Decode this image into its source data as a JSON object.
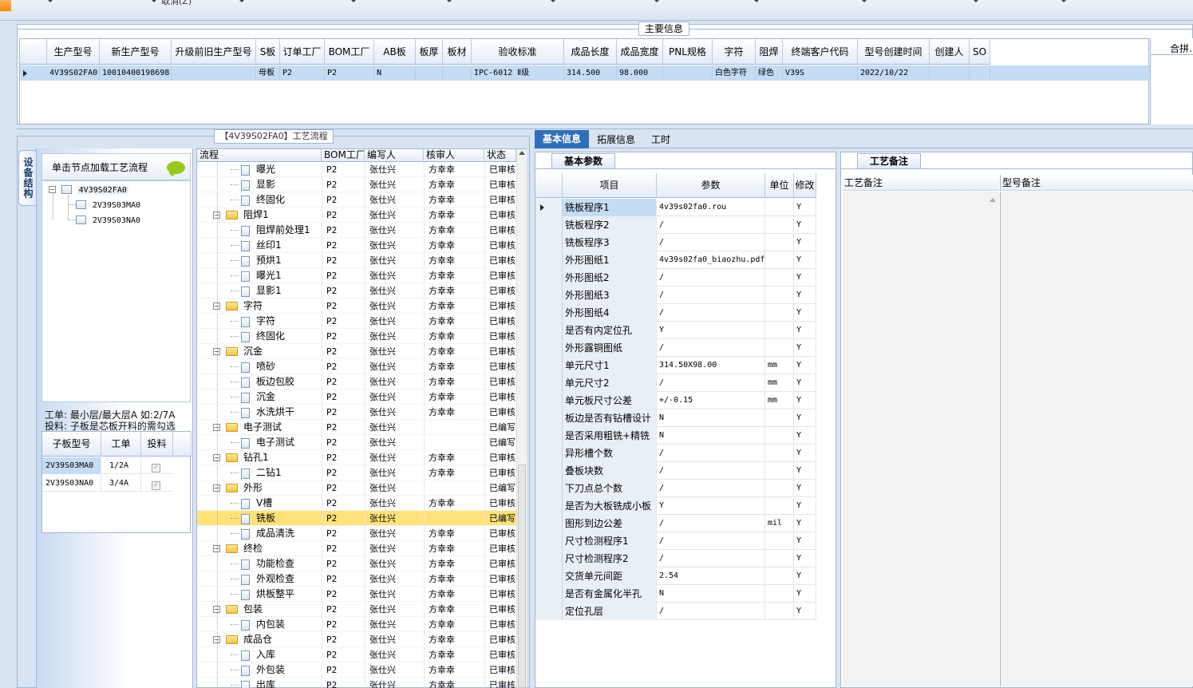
{
  "top_toolbar": {
    "partial_label": "取消(Z)"
  },
  "main_info": {
    "title": "主要信息",
    "columns": [
      "生产型号",
      "新生产型号",
      "升级前旧生产型号",
      "S板",
      "订单工厂",
      "BOM工厂",
      "AB板",
      "板厚",
      "板材",
      "验收标准",
      "成品长度",
      "成品宽度",
      "PNL规格",
      "字符",
      "阻焊",
      "终端客户代码",
      "型号创建时间",
      "创建人",
      "SO"
    ],
    "row": [
      "4V39S02FA0",
      "10010400198698",
      "",
      "母板",
      "P2",
      "P2",
      "N",
      "",
      "",
      "IPC-6012 Ⅱ级",
      "314.500",
      "98.000",
      "",
      "白色字符",
      "绿色",
      "V39S",
      "2022/10/22",
      "",
      ""
    ],
    "side_title": "合拼..."
  },
  "flow_title": "【4V39S02FA0】工艺流程",
  "vertical_tab": "设备结构",
  "tree_panel": {
    "hint": "单击节点加载工艺流程",
    "root": "4V39S02FA0",
    "children": [
      "2V39S03MA0",
      "2V39S03NA0"
    ]
  },
  "note": {
    "line1": "工单: 最小层/最大层A 如:2/7A",
    "line2": "投料: 子板是芯板开料的需勾选"
  },
  "sub_table": {
    "columns": [
      "子板型号",
      "工单",
      "投料"
    ],
    "rows": [
      [
        "2V39S03MA0",
        "1/2A",
        true
      ],
      [
        "2V39S03NA0",
        "3/4A",
        true
      ]
    ]
  },
  "process": {
    "columns": [
      "流程",
      "BOM工厂",
      "编写人",
      "核审人",
      "状态"
    ],
    "rows": [
      {
        "name": "曝光",
        "level": 2,
        "bom": "P2",
        "writer": "张仕兴",
        "reviewer": "方幸幸",
        "status": "已审核"
      },
      {
        "name": "显影",
        "level": 2,
        "bom": "P2",
        "writer": "张仕兴",
        "reviewer": "方幸幸",
        "status": "已审核"
      },
      {
        "name": "终固化",
        "level": 2,
        "bom": "P2",
        "writer": "张仕兴",
        "reviewer": "方幸幸",
        "status": "已审核"
      },
      {
        "name": "阻焊1",
        "level": 1,
        "bom": "P2",
        "writer": "张仕兴",
        "reviewer": "方幸幸",
        "status": "已审核"
      },
      {
        "name": "阻焊前处理1",
        "level": 2,
        "bom": "P2",
        "writer": "张仕兴",
        "reviewer": "方幸幸",
        "status": "已审核"
      },
      {
        "name": "丝印1",
        "level": 2,
        "bom": "P2",
        "writer": "张仕兴",
        "reviewer": "方幸幸",
        "status": "已审核"
      },
      {
        "name": "预烘1",
        "level": 2,
        "bom": "P2",
        "writer": "张仕兴",
        "reviewer": "方幸幸",
        "status": "已审核"
      },
      {
        "name": "曝光1",
        "level": 2,
        "bom": "P2",
        "writer": "张仕兴",
        "reviewer": "方幸幸",
        "status": "已审核"
      },
      {
        "name": "显影1",
        "level": 2,
        "bom": "P2",
        "writer": "张仕兴",
        "reviewer": "方幸幸",
        "status": "已审核"
      },
      {
        "name": "字符",
        "level": 1,
        "bom": "P2",
        "writer": "张仕兴",
        "reviewer": "方幸幸",
        "status": "已审核"
      },
      {
        "name": "字符",
        "level": 2,
        "bom": "P2",
        "writer": "张仕兴",
        "reviewer": "方幸幸",
        "status": "已审核"
      },
      {
        "name": "终固化",
        "level": 2,
        "bom": "P2",
        "writer": "张仕兴",
        "reviewer": "方幸幸",
        "status": "已审核"
      },
      {
        "name": "沉金",
        "level": 1,
        "bom": "P2",
        "writer": "张仕兴",
        "reviewer": "方幸幸",
        "status": "已审核"
      },
      {
        "name": "喷砂",
        "level": 2,
        "bom": "P2",
        "writer": "张仕兴",
        "reviewer": "方幸幸",
        "status": "已审核"
      },
      {
        "name": "板边包胶",
        "level": 2,
        "bom": "P2",
        "writer": "张仕兴",
        "reviewer": "方幸幸",
        "status": "已审核"
      },
      {
        "name": "沉金",
        "level": 2,
        "bom": "P2",
        "writer": "张仕兴",
        "reviewer": "方幸幸",
        "status": "已审核"
      },
      {
        "name": "水洗烘干",
        "level": 2,
        "bom": "P2",
        "writer": "张仕兴",
        "reviewer": "方幸幸",
        "status": "已审核"
      },
      {
        "name": "电子测试",
        "level": 1,
        "bom": "P2",
        "writer": "张仕兴",
        "reviewer": "",
        "status": "已编写"
      },
      {
        "name": "电子测试",
        "level": 2,
        "bom": "P2",
        "writer": "张仕兴",
        "reviewer": "",
        "status": "已编写"
      },
      {
        "name": "钻孔1",
        "level": 1,
        "bom": "P2",
        "writer": "张仕兴",
        "reviewer": "方幸幸",
        "status": "已审核"
      },
      {
        "name": "二钻1",
        "level": 2,
        "bom": "P2",
        "writer": "张仕兴",
        "reviewer": "方幸幸",
        "status": "已审核"
      },
      {
        "name": "外形",
        "level": 1,
        "bom": "P2",
        "writer": "张仕兴",
        "reviewer": "",
        "status": "已编写"
      },
      {
        "name": "V槽",
        "level": 2,
        "bom": "P2",
        "writer": "张仕兴",
        "reviewer": "方幸幸",
        "status": "已审核"
      },
      {
        "name": "铣板",
        "level": 2,
        "bom": "P2",
        "writer": "张仕兴",
        "reviewer": "",
        "status": "已编写",
        "selected": true
      },
      {
        "name": "成品清洗",
        "level": 2,
        "bom": "P2",
        "writer": "张仕兴",
        "reviewer": "方幸幸",
        "status": "已审核"
      },
      {
        "name": "终检",
        "level": 1,
        "bom": "P2",
        "writer": "张仕兴",
        "reviewer": "方幸幸",
        "status": "已审核"
      },
      {
        "name": "功能检查",
        "level": 2,
        "bom": "P2",
        "writer": "张仕兴",
        "reviewer": "方幸幸",
        "status": "已审核"
      },
      {
        "name": "外观检查",
        "level": 2,
        "bom": "P2",
        "writer": "张仕兴",
        "reviewer": "方幸幸",
        "status": "已审核"
      },
      {
        "name": "烘板整平",
        "level": 2,
        "bom": "P2",
        "writer": "张仕兴",
        "reviewer": "方幸幸",
        "status": "已审核"
      },
      {
        "name": "包装",
        "level": 1,
        "bom": "P2",
        "writer": "张仕兴",
        "reviewer": "方幸幸",
        "status": "已审核"
      },
      {
        "name": "内包装",
        "level": 2,
        "bom": "P2",
        "writer": "张仕兴",
        "reviewer": "方幸幸",
        "status": "已审核"
      },
      {
        "name": "成品仓",
        "level": 1,
        "bom": "P2",
        "writer": "张仕兴",
        "reviewer": "方幸幸",
        "status": "已审核"
      },
      {
        "name": "入库",
        "level": 2,
        "bom": "P2",
        "writer": "张仕兴",
        "reviewer": "方幸幸",
        "status": "已审核"
      },
      {
        "name": "外包装",
        "level": 2,
        "bom": "P2",
        "writer": "张仕兴",
        "reviewer": "方幸幸",
        "status": "已审核"
      },
      {
        "name": "出库",
        "level": 2,
        "bom": "P2",
        "writer": "张仕兴",
        "reviewer": "方幸幸",
        "status": "已审核"
      }
    ]
  },
  "right_tabs": [
    "基本信息",
    "拓展信息",
    "工时"
  ],
  "params": {
    "tab": "基本参数",
    "columns": [
      "项目",
      "参数",
      "单位",
      "修改"
    ],
    "rows": [
      [
        "铣板程序1",
        "4v39s02fa0.rou",
        "",
        "Y"
      ],
      [
        "铣板程序2",
        "/",
        "",
        "Y"
      ],
      [
        "铣板程序3",
        "/",
        "",
        "Y"
      ],
      [
        "外形图纸1",
        "4v39s02fa0_biaozhu.pdf",
        "",
        "Y"
      ],
      [
        "外形图纸2",
        "/",
        "",
        "Y"
      ],
      [
        "外形图纸3",
        "/",
        "",
        "Y"
      ],
      [
        "外形图纸4",
        "/",
        "",
        "Y"
      ],
      [
        "是否有内定位孔",
        "Y",
        "",
        "Y"
      ],
      [
        "外形露铜图纸",
        "/",
        "",
        "Y"
      ],
      [
        "单元尺寸1",
        "314.50X98.00",
        "mm",
        "Y"
      ],
      [
        "单元尺寸2",
        "/",
        "mm",
        "Y"
      ],
      [
        "单元板尺寸公差",
        "+/-0.15",
        "mm",
        "Y"
      ],
      [
        "板边是否有钻槽设计",
        "N",
        "",
        "Y"
      ],
      [
        "是否采用粗铣+精铣",
        "N",
        "",
        "Y"
      ],
      [
        "异形槽个数",
        "/",
        "",
        "Y"
      ],
      [
        "叠板块数",
        "/",
        "",
        "Y"
      ],
      [
        "下刀点总个数",
        "/",
        "",
        "Y"
      ],
      [
        "是否为大板铣成小板",
        "Y",
        "",
        "Y"
      ],
      [
        "图形到边公差",
        "/",
        "mil",
        "Y"
      ],
      [
        "尺寸检测程序1",
        "/",
        "",
        "Y"
      ],
      [
        "尺寸检测程序2",
        "/",
        "",
        "Y"
      ],
      [
        "交货单元间距",
        "2.54",
        "",
        "Y"
      ],
      [
        "是否有金属化半孔",
        "N",
        "",
        "Y"
      ],
      [
        "定位孔层",
        "/",
        "",
        "Y"
      ]
    ]
  },
  "notes_panel": {
    "tab": "工艺备注",
    "col1": "工艺备注",
    "col2": "型号备注"
  },
  "colors": {
    "selection": "#c5dcf5",
    "highlight": "#ffe37a",
    "tab_active": "#2f6fb8"
  }
}
